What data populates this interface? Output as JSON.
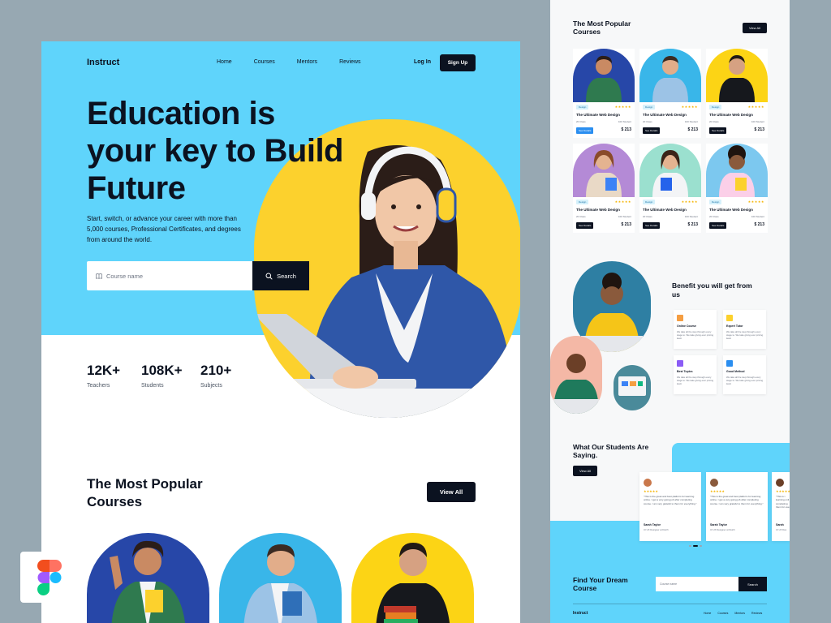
{
  "main": {
    "nav": {
      "logo": "Instruct",
      "links": [
        "Home",
        "Courses",
        "Mentors",
        "Reviews"
      ],
      "login": "Log In",
      "signup": "Sign Up"
    },
    "hero": {
      "headline_lines": [
        "Education is",
        "your key to Build",
        "Future"
      ],
      "subtext": "Start, switch, or advance your career with more than 5,000 courses, Professional Certificates, and degrees from around the world.",
      "search_placeholder": "Course name",
      "search_button": "Search"
    },
    "stats": [
      {
        "value": "12K+",
        "label": "Teachers"
      },
      {
        "value": "108K+",
        "label": "Students"
      },
      {
        "value": "210+",
        "label": "Subjects"
      }
    ],
    "popular": {
      "title": "The Most Popular Courses",
      "view_all": "View All"
    }
  },
  "side": {
    "popular_title": "The Most Popular Courses",
    "view_all": "View All",
    "course_cards": [
      {
        "tag": "Design",
        "title": "The Ultimate Web Design",
        "classes": "20 Class",
        "students": "100 Student",
        "button": "See Details",
        "price": "$ 213"
      },
      {
        "tag": "Design",
        "title": "The Ultimate Web Design",
        "classes": "20 Class",
        "students": "100 Student",
        "button": "See Details",
        "price": "$ 213"
      },
      {
        "tag": "Design",
        "title": "The Ultimate Web Design",
        "classes": "20 Class",
        "students": "100 Student",
        "button": "See Details",
        "price": "$ 213"
      },
      {
        "tag": "Design",
        "title": "The Ultimate Web Design",
        "classes": "20 Class",
        "students": "100 Student",
        "button": "See Details",
        "price": "$ 213"
      },
      {
        "tag": "Design",
        "title": "The Ultimate Web Design",
        "classes": "20 Class",
        "students": "100 Student",
        "button": "See Details",
        "price": "$ 213"
      },
      {
        "tag": "Design",
        "title": "The Ultimate Web Design",
        "classes": "20 Class",
        "students": "100 Student",
        "button": "See Details",
        "price": "$ 213"
      }
    ],
    "card_stars": "★★★★★",
    "benefit_title": "Benefit you will get from us",
    "benefits": [
      {
        "title": "Online Course",
        "desc": "We take all the step through every stage to. We take giving ever pricing learn",
        "color": "#f59e42"
      },
      {
        "title": "Expert Tutor",
        "desc": "We take all the step through every stage to. We take giving ever pricing learn",
        "color": "#fcd12d"
      },
      {
        "title": "Best Topics",
        "desc": "We take all the step through every stage to. We take giving ever pricing learn",
        "color": "#8b5cf6"
      },
      {
        "title": "Good Method",
        "desc": "We take all the step through every stage to. We take giving ever pricing learn",
        "color": "#2a8ef0"
      }
    ],
    "testimonials_title": "What Our Students Are Saying.",
    "testimonials_view_all": "View All",
    "testimonials": [
      {
        "stars": "★★★★★",
        "quote": "\"This is the great and best platform for learning online. I get a very going job after completing course. I am very grateful to them for everything.\"",
        "name": "Sarah Taylor",
        "role": "UI UX Designer at Dutch"
      },
      {
        "stars": "★★★★★",
        "quote": "\"This is the great and best platform for learning online. I get a very going job after completing course. I am very grateful to them for everything.\"",
        "name": "Sarah Taylor",
        "role": "UI UX Designer at Dutch"
      },
      {
        "stars": "★★★★★",
        "quote": "\"This is t learning onli completing them for eve",
        "name": "Sarah",
        "role": "UI UX Des"
      }
    ],
    "footer": {
      "cta": "Find Your Dream Course",
      "search_placeholder": "Course name",
      "search_button": "Search",
      "logo": "Instruct",
      "links": [
        "Home",
        "Courses",
        "Mentors",
        "Reviews"
      ]
    }
  },
  "colors": {
    "background": "#97a8b2",
    "hero_blue": "#5fd4fb",
    "accent_yellow": "#fcd12d",
    "dark": "#0b1220"
  }
}
